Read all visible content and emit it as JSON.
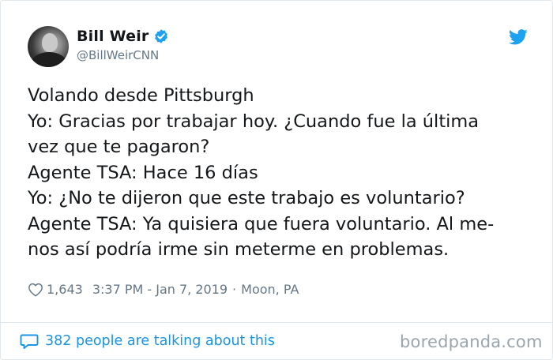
{
  "tweet": {
    "author": {
      "display_name": "Bill Weir",
      "handle": "@BillWeirCNN",
      "verified": true
    },
    "text_lines": [
      "Volando desde Pittsburgh",
      "Yo: Gracias por trabajar hoy. ¿Cuando fue la última",
      "vez que te pagaron?",
      "Agente TSA: Hace 16 días",
      "Yo: ¿No te dijeron que este trabajo es voluntario?",
      "Agente TSA: Ya quisiera que fuera voluntario. Al me-",
      "nos así podría irme sin meterme en problemas."
    ],
    "likes": "1,643",
    "timestamp": "3:37 PM - Jan 7, 2019",
    "separator": "·",
    "location": "Moon, PA",
    "talking_about": "382 people are talking about this"
  },
  "icons": {
    "like": "heart-icon",
    "reply": "speech-bubble-icon",
    "brand": "twitter-bird-icon",
    "verified": "verified-badge-icon"
  },
  "watermark": "boredpanda.com",
  "colors": {
    "twitter_blue": "#1da1f2",
    "link_blue": "#1b95e0",
    "muted_text": "#657786",
    "primary_text": "#14171a",
    "border": "#e1e8ed"
  }
}
